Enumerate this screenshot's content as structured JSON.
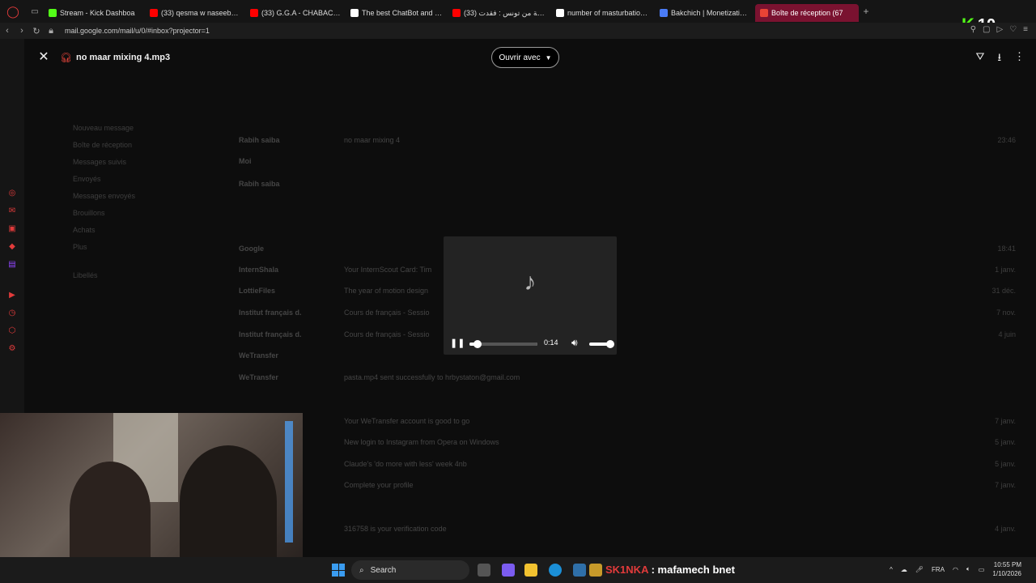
{
  "browser": {
    "tabs": [
      {
        "label": "Stream - Kick Dashboa",
        "color": "#53fc18",
        "active": false
      },
      {
        "label": "(33) qesma w naseeb higt",
        "color": "#ff0000",
        "active": false
      },
      {
        "label": "(33) G.G.A - CHABACHA",
        "color": "#ff0000",
        "active": false
      },
      {
        "label": "The best ChatBot and Wid",
        "color": "#ffffff",
        "active": false
      },
      {
        "label": "(33) روضة من تونس : فقدت",
        "color": "#ff0000",
        "active": false
      },
      {
        "label": "number of masturbation a",
        "color": "#ffffff",
        "active": false
      },
      {
        "label": "Bakchich | Monetization fo",
        "color": "#4a7cf7",
        "active": false
      },
      {
        "label": "Boîte de réception (67",
        "color": "#ea4335",
        "active": true
      }
    ],
    "url": "mail.google.com/mail/u/0/#inbox?projector=1",
    "kick_badge": "10"
  },
  "gmail": {
    "nav": [
      "Nouveau message",
      "Boîte de réception",
      "Messages suivis",
      "Envoyés",
      "Messages envoyés",
      "Brouillons",
      "Achats",
      "Plus",
      "Libellés"
    ],
    "rows": [
      {
        "from": "Rabih saiba",
        "subject": "no maar mixing 4",
        "date": "23:46"
      },
      {
        "from": "Moi",
        "subject": "",
        "date": ""
      },
      {
        "from": "Rabih saiba",
        "subject": "",
        "date": ""
      },
      {
        "from": "Google",
        "subject": "",
        "date": "18:41"
      },
      {
        "from": "InternShala",
        "subject": "Your InternScout Card: Tim",
        "date": "1 janv."
      },
      {
        "from": "LottieFiles",
        "subject": "The year of motion design",
        "date": "31 déc."
      },
      {
        "from": "Institut français d.",
        "subject": "Cours de français - Sessio",
        "date": "7 nov."
      },
      {
        "from": "Institut français d.",
        "subject": "Cours de français - Sessio",
        "date": "4 juin"
      },
      {
        "from": "WeTransfer",
        "subject": "",
        "date": ""
      },
      {
        "from": "WeTransfer",
        "subject": "pasta.mp4 sent successfully to hrbystaton@gmail.com",
        "date": ""
      },
      {
        "from": "",
        "subject": "",
        "date": ""
      },
      {
        "from": "",
        "subject": "Your WeTransfer account is good to go",
        "date": "7 janv."
      },
      {
        "from": "",
        "subject": "New login to Instagram from Opera on Windows",
        "date": "5 janv."
      },
      {
        "from": "",
        "subject": "Claude's 'do more with less' week 4nb",
        "date": "5 janv."
      },
      {
        "from": "",
        "subject": "Complete your profile",
        "date": "7 janv."
      },
      {
        "from": "",
        "subject": "",
        "date": ""
      },
      {
        "from": "",
        "subject": "316758 is your verification code",
        "date": "4 janv."
      }
    ]
  },
  "preview": {
    "close_icon": "close-icon",
    "file_name": "no maar mixing 4.mp3",
    "open_with_label": "Ouvrir avec",
    "player": {
      "current_time": "0:14",
      "progress": 0.12,
      "volume": 1.0,
      "state": "playing"
    }
  },
  "taskbar": {
    "search_label": "Search",
    "overlay_highlight": "SK1NKA",
    "overlay_text": ": mafamech bnet",
    "language": "FRA",
    "time": "10:55 PM",
    "date": "1/10/2026"
  }
}
